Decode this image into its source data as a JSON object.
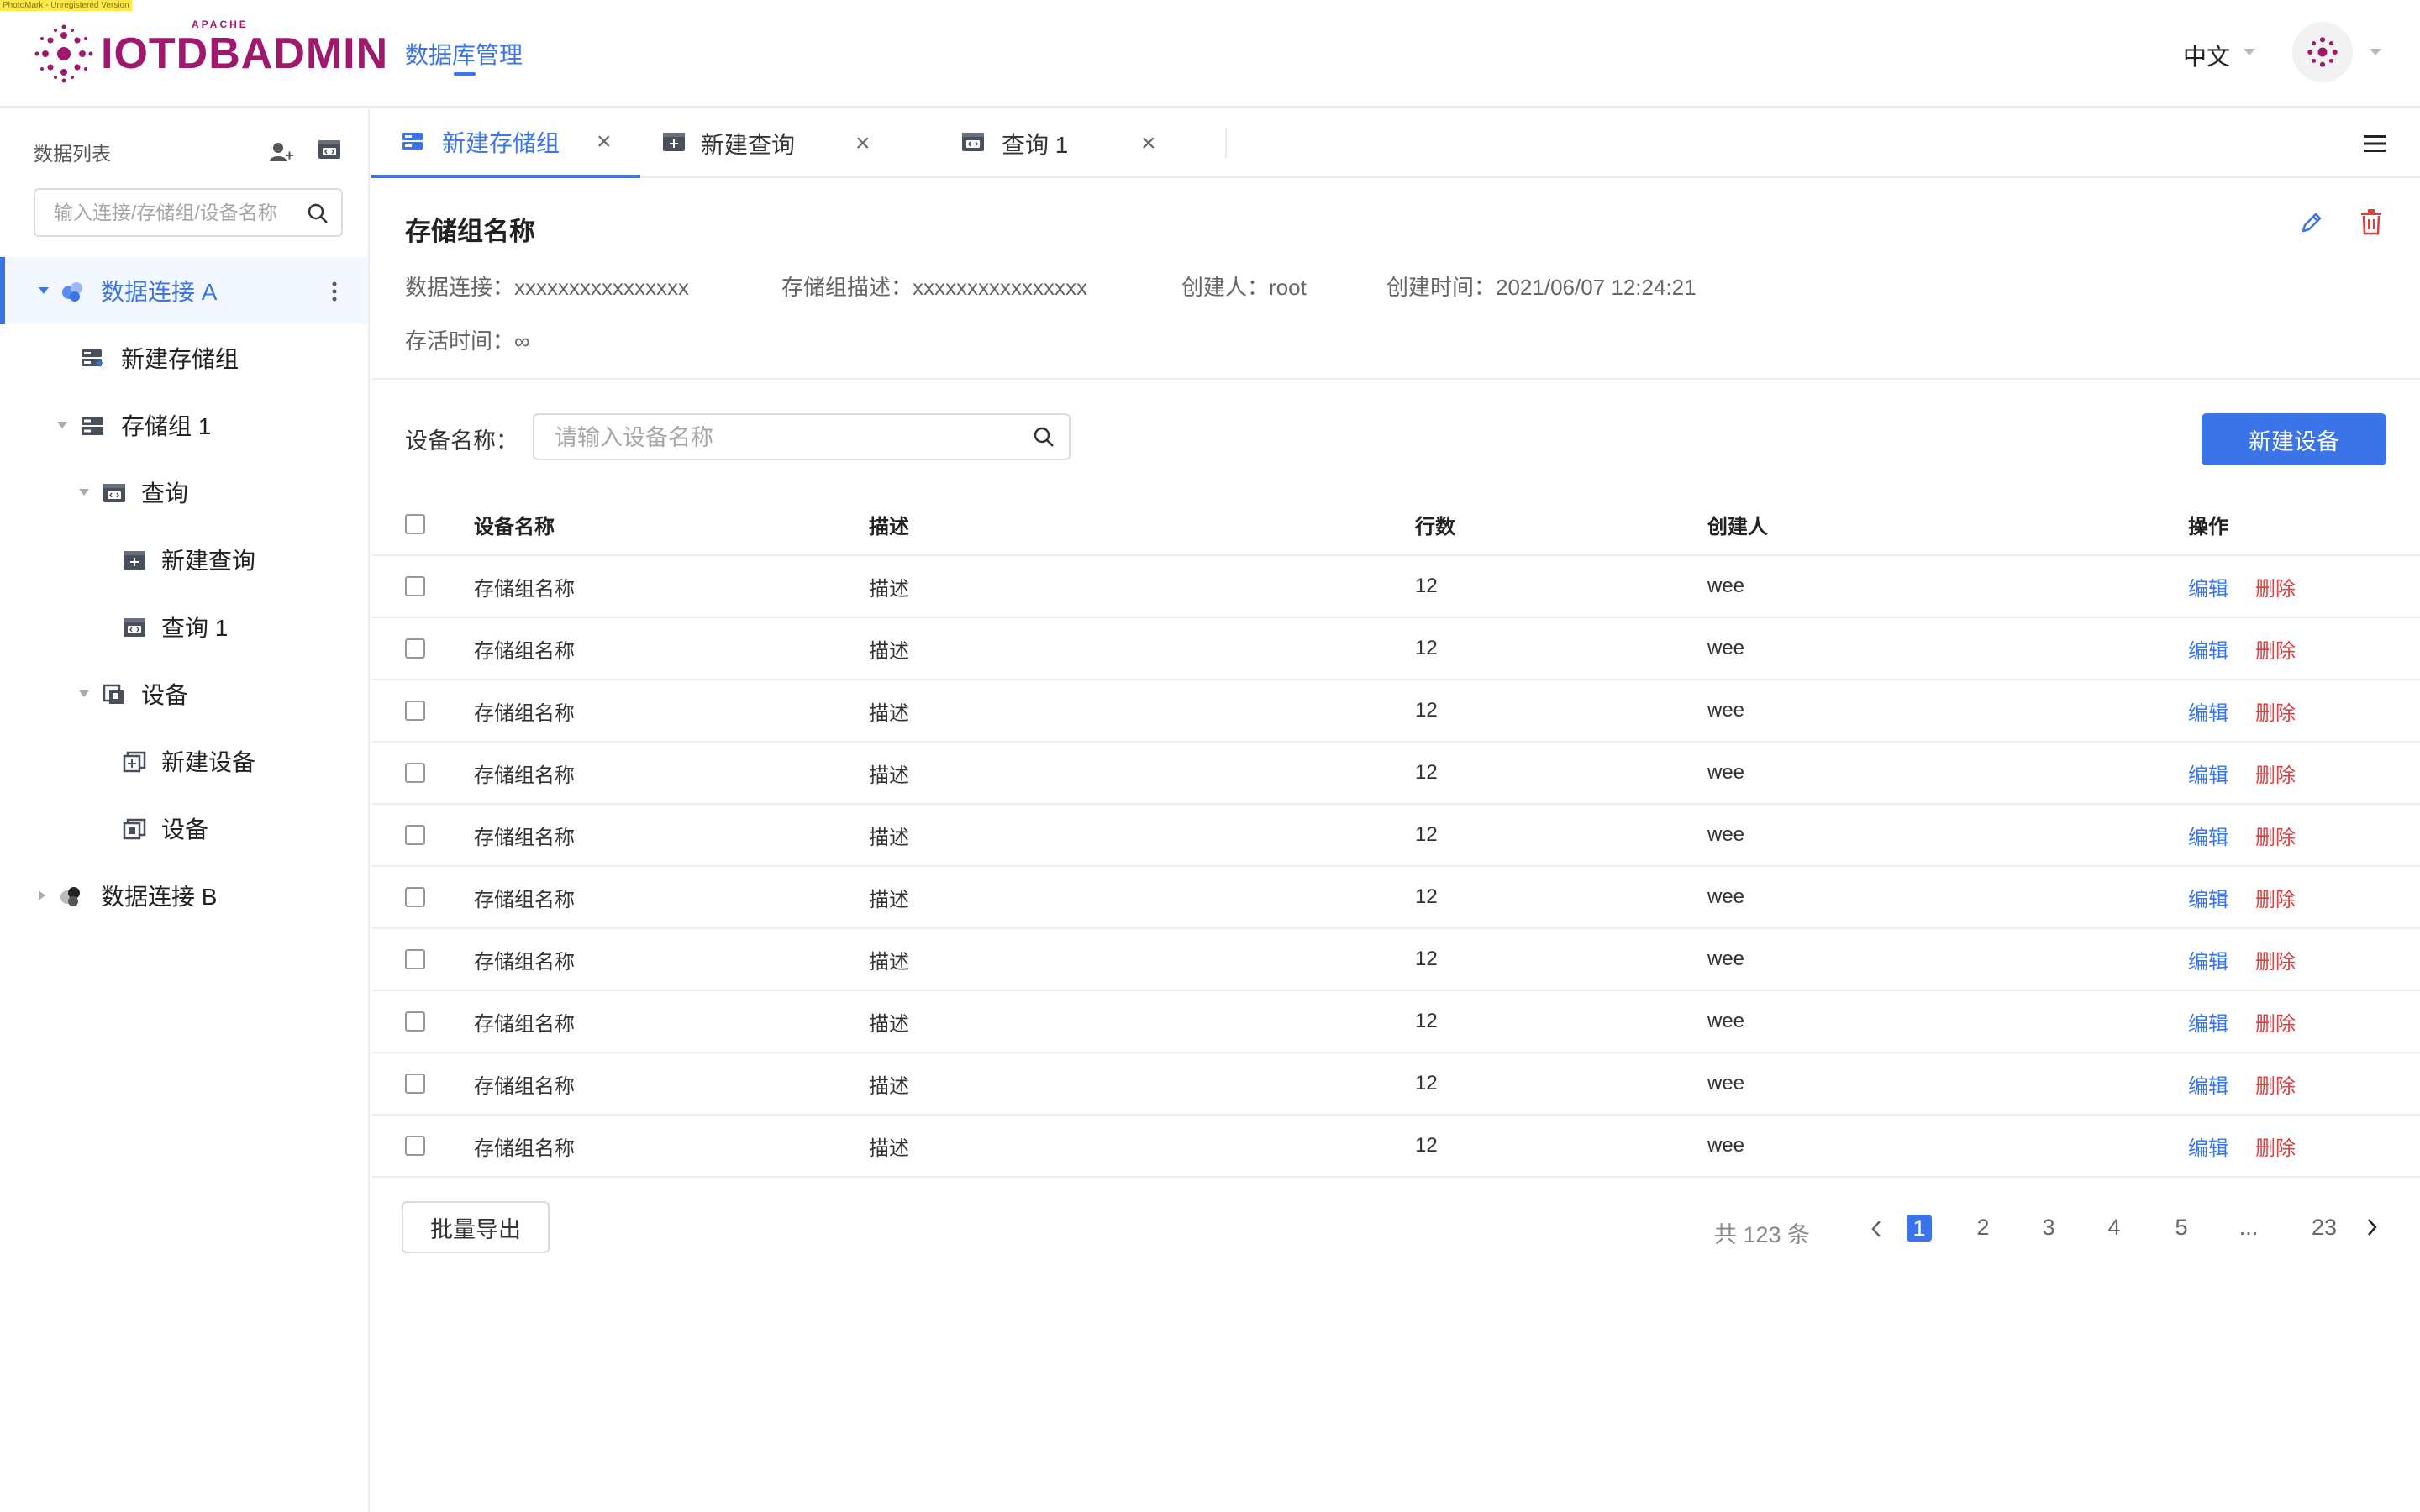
{
  "stamp": "PhotoMark - Unregistered Version",
  "header": {
    "logo_text": "IOTDBADMIN",
    "logo_super": "APACHE",
    "nav_title": "数据库管理",
    "language": "中文"
  },
  "sidebar": {
    "title": "数据列表",
    "search_placeholder": "输入连接/存储组/设备名称",
    "tree": {
      "conn_a": "数据连接 A",
      "new_group": "新建存储组",
      "group1": "存储组 1",
      "query": "查询",
      "new_query": "新建查询",
      "query1": "查询 1",
      "device": "设备",
      "new_device": "新建设备",
      "device_item": "设备",
      "conn_b": "数据连接 B"
    }
  },
  "tabs": [
    {
      "label": "新建存储组",
      "active": true
    },
    {
      "label": "新建查询",
      "active": false
    },
    {
      "label": "查询 1",
      "active": false
    }
  ],
  "detail": {
    "title": "存储组名称",
    "connection_label": "数据连接：",
    "connection_value": "xxxxxxxxxxxxxxxx",
    "desc_label": "存储组描述：",
    "desc_value": "xxxxxxxxxxxxxxxx",
    "creator_label": "创建人：",
    "creator_value": "root",
    "created_label": "创建时间：",
    "created_value": "2021/06/07 12:24:21",
    "ttl_label": "存活时间：",
    "ttl_value": "∞"
  },
  "filter": {
    "label": "设备名称：",
    "placeholder": "请输入设备名称",
    "new_button": "新建设备"
  },
  "table": {
    "headers": [
      "设备名称",
      "描述",
      "行数",
      "创建人",
      "操作"
    ],
    "edit_label": "编辑",
    "delete_label": "删除",
    "rows": [
      {
        "name": "存储组名称",
        "desc": "描述",
        "rows": "12",
        "creator": "wee"
      },
      {
        "name": "存储组名称",
        "desc": "描述",
        "rows": "12",
        "creator": "wee"
      },
      {
        "name": "存储组名称",
        "desc": "描述",
        "rows": "12",
        "creator": "wee"
      },
      {
        "name": "存储组名称",
        "desc": "描述",
        "rows": "12",
        "creator": "wee"
      },
      {
        "name": "存储组名称",
        "desc": "描述",
        "rows": "12",
        "creator": "wee"
      },
      {
        "name": "存储组名称",
        "desc": "描述",
        "rows": "12",
        "creator": "wee"
      },
      {
        "name": "存储组名称",
        "desc": "描述",
        "rows": "12",
        "creator": "wee"
      },
      {
        "name": "存储组名称",
        "desc": "描述",
        "rows": "12",
        "creator": "wee"
      },
      {
        "name": "存储组名称",
        "desc": "描述",
        "rows": "12",
        "creator": "wee"
      },
      {
        "name": "存储组名称",
        "desc": "描述",
        "rows": "12",
        "creator": "wee"
      }
    ]
  },
  "footer": {
    "export_button": "批量导出",
    "total": "共 123 条",
    "pages": [
      "1",
      "2",
      "3",
      "4",
      "5",
      "...",
      "23"
    ],
    "current_page": "1"
  },
  "colors": {
    "primary": "#3b73e8",
    "danger": "#e23c3c",
    "brand": "#a0176e"
  }
}
